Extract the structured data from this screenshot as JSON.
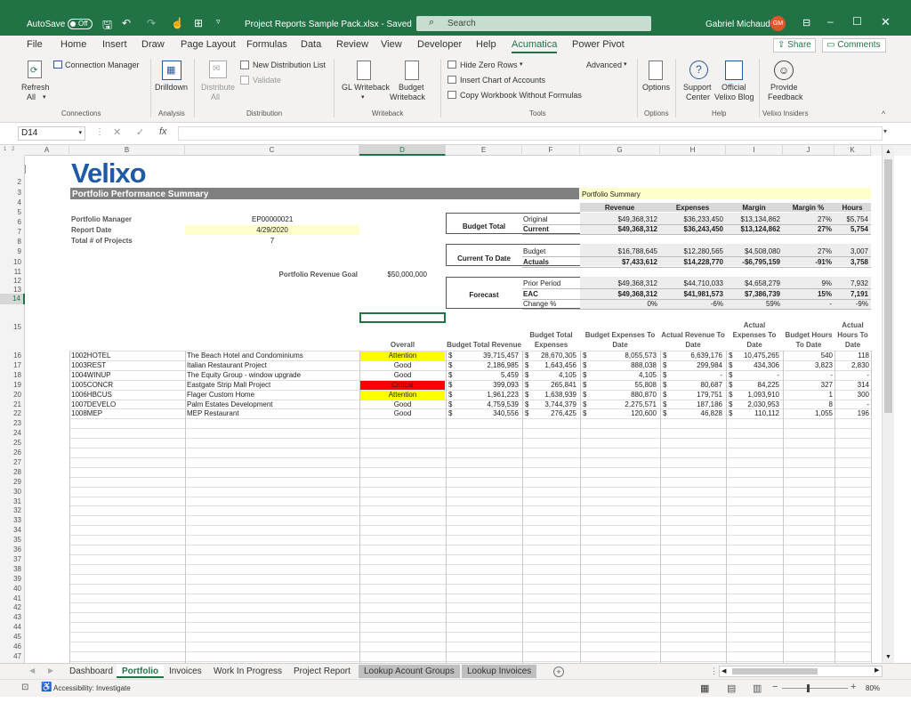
{
  "window": {
    "autosave": "AutoSave",
    "autosave_state": "Off",
    "file_title": "Project Reports Sample Pack.xlsx - Saved",
    "search_placeholder": "Search",
    "user": "Gabriel Michaud",
    "initials": "GM"
  },
  "menu": [
    "File",
    "Home",
    "Insert",
    "Draw",
    "Page Layout",
    "Formulas",
    "Data",
    "Review",
    "View",
    "Developer",
    "Help",
    "Acumatica",
    "Power Pivot"
  ],
  "share": "Share",
  "comments": "Comments",
  "ribbon": {
    "connection_manager": "Connection Manager",
    "refresh": "Refresh",
    "refresh_sub": "All",
    "drilldown": "Drilldown",
    "distribute": "Distribute",
    "distribute_sub": "All",
    "new_dist_list": "New Distribution List",
    "validate": "Validate",
    "gl_writeback": "GL Writeback",
    "budget": "Budget",
    "budget_writeback": "Writeback",
    "hide_zero": "Hide Zero Rows",
    "insert_coa": "Insert Chart of Accounts",
    "copy_wb": "Copy Workbook Without Formulas",
    "advanced": "Advanced",
    "options": "Options",
    "support": "Support",
    "support2": "Center",
    "official": "Official",
    "official2": "Velixo Blog",
    "provide": "Provide",
    "feedback": "Feedback",
    "groups": [
      "Connections",
      "Analysis",
      "Distribution",
      "Writeback",
      "Tools",
      "Options",
      "Help",
      "Velixo Insiders"
    ]
  },
  "formula": {
    "name_box": "D14",
    "fx": "fx",
    "value": ""
  },
  "columns": [
    "A",
    "B",
    "C",
    "D",
    "E",
    "F",
    "G",
    "H",
    "I",
    "J",
    "K"
  ],
  "sheet": {
    "logo": "Velixo",
    "title": "Portfolio Performance Summary",
    "portfolio_summary": "Portfolio Summary",
    "pm_label": "Portfolio Manager",
    "pm_value": "EP00000021",
    "date_label": "Report Date",
    "date_value": "4/29/2020",
    "proj_label": "Total # of Projects",
    "proj_value": "7",
    "goal_label": "Portfolio Revenue Goal",
    "goal_value": "$50,000,000",
    "sum_headers": [
      "Revenue",
      "Expenses",
      "Margin",
      "Margin %",
      "Hours"
    ],
    "budget_total": "Budget Total",
    "current_to_date": "Current To Date",
    "forecast": "Forecast",
    "sum_rows": [
      [
        "Original",
        "$49,368,312",
        "$36,233,450",
        "$13,134,862",
        "27%",
        "$5,754"
      ],
      [
        "Current",
        "$49,368,312",
        "$36,243,450",
        "$13,124,862",
        "27%",
        "5,754"
      ],
      [
        "Budget",
        "$16,788,645",
        "$12,280,565",
        "$4,508,080",
        "27%",
        "3,007"
      ],
      [
        "Actuals",
        "$7,433,612",
        "$14,228,770",
        "-$6,795,159",
        "-91%",
        "3,758"
      ],
      [
        "Prior Period",
        "$49,368,312",
        "$44,710,033",
        "$4,658,279",
        "9%",
        "7,932"
      ],
      [
        "EAC",
        "$49,368,312",
        "$41,981,573",
        "$7,386,739",
        "15%",
        "7,191"
      ],
      [
        "Change %",
        "0%",
        "-6%",
        "59%",
        "-",
        "-9%"
      ]
    ],
    "proj_headers": [
      "Overall",
      "Budget Total Revenue",
      "Budget Total Expenses",
      "Budget Expenses To Date",
      "Actual Revenue To Date",
      "Actual Expenses To Date",
      "Budget Hours To Date",
      "Actual Hours To Date"
    ],
    "projects": [
      {
        "id": "1002HOTEL",
        "name": "The Beach Hotel and Condominiums",
        "status": "Attention",
        "v": [
          "39,715,457",
          "28,670,305",
          "8,055,573",
          "6,639,176",
          "10,475,265"
        ],
        "bh": "540",
        "ah": "118"
      },
      {
        "id": "1003REST",
        "name": "Italian Restaurant Project",
        "status": "Good",
        "v": [
          "2,186,985",
          "1,643,456",
          "888,038",
          "299,984",
          "434,306"
        ],
        "bh": "3,823",
        "ah": "2,830"
      },
      {
        "id": "1004WINUP",
        "name": "The Equity Group - window upgrade",
        "status": "Good",
        "v": [
          "5,459",
          "4,105",
          "4,105",
          "-",
          "-"
        ],
        "bh": "-",
        "ah": "-"
      },
      {
        "id": "1005CONCR",
        "name": "Eastgate Strip Mall Project",
        "status": "Critical",
        "v": [
          "399,093",
          "265,841",
          "55,808",
          "80,687",
          "84,225"
        ],
        "bh": "327",
        "ah": "314"
      },
      {
        "id": "1006HBCUS",
        "name": "Flager Custom Home",
        "status": "Attention",
        "v": [
          "1,961,223",
          "1,638,939",
          "880,870",
          "179,751",
          "1,093,910"
        ],
        "bh": "1",
        "ah": "300"
      },
      {
        "id": "1007DEVELO",
        "name": "Palm Estates Development",
        "status": "Good",
        "v": [
          "4,759,539",
          "3,744,379",
          "2,275,571",
          "187,186",
          "2,030,953"
        ],
        "bh": "8",
        "ah": "-"
      },
      {
        "id": "1008MEP",
        "name": "MEP Restaurant",
        "status": "Good",
        "v": [
          "340,556",
          "276,425",
          "120,600",
          "46,828",
          "110,112"
        ],
        "bh": "1,055",
        "ah": "196"
      }
    ],
    "dollar": "$"
  },
  "tabs": [
    "Dashboard",
    "Portfolio",
    "Invoices",
    "Work In Progress",
    "Project Report",
    "Lookup Acount Groups",
    "Lookup Invoices"
  ],
  "status": {
    "accessibility": "Accessibility: Investigate",
    "zoom": "80%"
  },
  "colors": {
    "excel_green": "#217346",
    "attention": "#ffff00",
    "critical": "#ff0000",
    "input_fill": "#ffffcc",
    "header_gray": "#808080",
    "summary_gray": "#e7e6e6",
    "logo_blue": "#1f5aa6"
  }
}
